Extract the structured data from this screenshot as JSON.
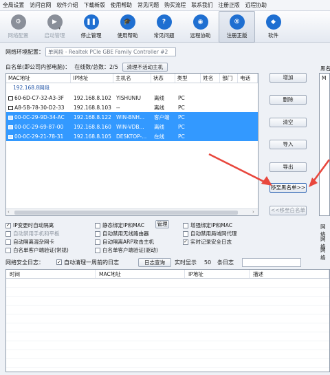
{
  "menu": [
    "全局设置",
    "访问官网",
    "软件介绍",
    "下载新版",
    "使用帮助",
    "常见问题",
    "购买流程",
    "联系我们",
    "注册正版",
    "远程协助"
  ],
  "toolbar": [
    {
      "label": "网络配置",
      "icon": "gear-icon",
      "color": "#8a8f99",
      "disabled": true
    },
    {
      "label": "启动管理",
      "icon": "play-icon",
      "color": "#8a8f99",
      "disabled": true
    },
    {
      "label": "停止管理",
      "icon": "pause-icon",
      "color": "#1f6fd1",
      "disabled": false
    },
    {
      "label": "使用帮助",
      "icon": "graduation-cap-icon",
      "color": "#1f6fd1",
      "disabled": false
    },
    {
      "label": "常见问题",
      "icon": "question-icon",
      "color": "#1f6fd1",
      "disabled": false
    },
    {
      "label": "远程协助",
      "icon": "remote-icon",
      "color": "#1f6fd1",
      "disabled": false
    },
    {
      "label": "注册正版",
      "icon": "registered-icon",
      "color": "#1f6fd1",
      "disabled": false
    },
    {
      "label": "软件",
      "icon": "software-icon",
      "color": "#1f6fd1",
      "disabled": false
    }
  ],
  "network": {
    "label": "网络环境配置：",
    "value": "单网段 - Realtek PCIe GBE Family Controller #2"
  },
  "whitelist": {
    "title": "白名单(即公司内部电脑)：",
    "online_label": "在线数/总数：2/5",
    "clean_button": "清理不活动主机"
  },
  "table": {
    "columns": [
      "MAC地址",
      "IP地址",
      "主机名",
      "状态",
      "类型",
      "姓名",
      "部门",
      "电话"
    ],
    "group": "192.168.8网段",
    "rows": [
      {
        "mac": "60-6D-C7-32-A3-3F",
        "ip": "192.168.8.102",
        "host": "YISHUNIU",
        "status": "离线",
        "type": "PC",
        "selected": false
      },
      {
        "mac": "A8-5B-78-30-D2-33",
        "ip": "192.168.8.103",
        "host": "--",
        "status": "离线",
        "type": "PC",
        "selected": false
      },
      {
        "mac": "00-0C-29-9D-34-AC",
        "ip": "192.168.8.122",
        "host": "WIN-BNH...",
        "status": "客户端",
        "type": "PC",
        "selected": true
      },
      {
        "mac": "00-0C-29-69-87-00",
        "ip": "192.168.8.160",
        "host": "WIN-VDB...",
        "status": "离线",
        "type": "PC",
        "selected": true
      },
      {
        "mac": "00-0C-29-21-78-31",
        "ip": "192.168.8.105",
        "host": "DESKTOP-...",
        "status": "在线",
        "type": "PC",
        "selected": true
      }
    ]
  },
  "side_buttons": [
    "增加",
    "删除",
    "清空",
    "导入",
    "导出",
    "移至黑名单>>",
    "<<移至白名单"
  ],
  "right_labels": {
    "blacklist": "黑名",
    "col": "M",
    "side": [
      "网络",
      "网络",
      "网络"
    ]
  },
  "options": [
    {
      "label": "IP变更时自动隔离",
      "checked": true,
      "disabled": false
    },
    {
      "label": "自动禁用手机和平板",
      "checked": false,
      "disabled": true
    },
    {
      "label": "自动隔离混杂网卡",
      "checked": false,
      "disabled": false
    },
    {
      "label": "白名单客户端验证(常规)",
      "checked": false,
      "disabled": false
    },
    {
      "label": "静态绑定IP和MAC",
      "checked": false,
      "disabled": false
    },
    {
      "label": "自动禁用无线路由器",
      "checked": false,
      "disabled": false
    },
    {
      "label": "自动隔离ARP攻击主机",
      "checked": false,
      "disabled": false
    },
    {
      "label": "白名单客户端验证(驱动)",
      "checked": false,
      "disabled": false
    },
    {
      "label": "增强绑定IP和MAC",
      "checked": false,
      "disabled": false
    },
    {
      "label": "自动禁用局域网代理",
      "checked": false,
      "disabled": false
    },
    {
      "label": "实时记录安全日志",
      "checked": true,
      "disabled": false
    }
  ],
  "manage_button": "管理",
  "log": {
    "title": "网络安全日志：",
    "auto_clean": "自动清理一周前的日志",
    "query_button": "日志查询",
    "realtime_label": "实时显示",
    "count": "50",
    "unit": "条日志",
    "columns": [
      "时间",
      "MAC地址",
      "IP地址",
      "描述"
    ]
  },
  "colors": {
    "selection": "#3399ff",
    "arrow": "#e8473d"
  }
}
